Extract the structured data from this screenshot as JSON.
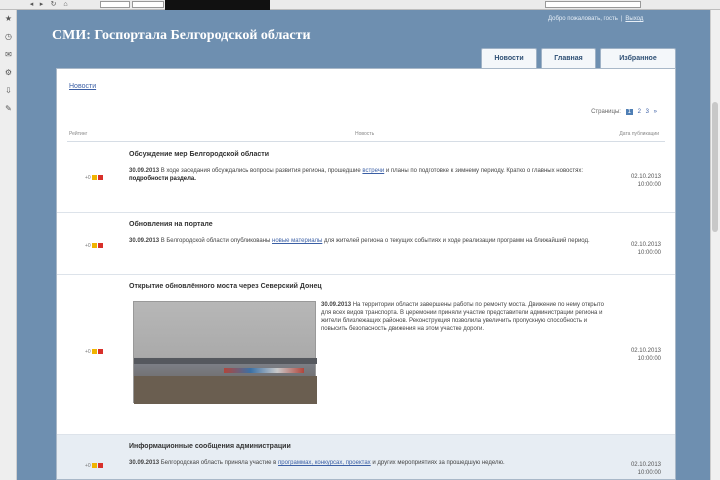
{
  "browser": {
    "nav_icons": [
      "back-icon",
      "forward-icon",
      "reload-icon",
      "home-icon"
    ],
    "url_value": "",
    "search_placeholder": "",
    "right_text": ""
  },
  "header": {
    "top_links": [
      "Добро пожаловать, гость",
      "Выход"
    ],
    "site_title": "СМИ: Госпортала Белгородской области"
  },
  "tabs": [
    {
      "label": "Новости"
    },
    {
      "label": "Главная"
    },
    {
      "label": "Избранное"
    }
  ],
  "main": {
    "breadcrumb": "Новости",
    "pager": {
      "label": "Страницы:",
      "pages": [
        "1",
        "2",
        "3",
        "»"
      ]
    },
    "columns": {
      "rating": "Рейтинг",
      "news": "Новость",
      "date": "Дата публикации"
    },
    "items": [
      {
        "title": "Обсуждение мер Белгородской области",
        "date_text": "30.09.2013",
        "text_a": " В ходе заседания обсуждались вопросы развития региона, прошедшие ",
        "link": "встречи",
        "text_b": " и планы по подготовке к зимнему периоду. Кратко о главных новостях:",
        "bold": " подробности раздела.",
        "rating": "+0",
        "date": "02.10.2013",
        "time": "10:00:00"
      },
      {
        "title": "Обновления на портале",
        "date_text": "30.09.2013",
        "text_a": " В Белгородской области опубликованы ",
        "link": "новые материалы",
        "text_b": " для жителей региона о текущих событиях и ходе реализации программ на ближайший период.",
        "bold": "",
        "rating": "+0",
        "date": "02.10.2013",
        "time": "10:00:00"
      },
      {
        "title": "Открытие обновлённого моста через Северский Донец",
        "date_text": "30.09.2013",
        "text_a": " На территории области завершены работы по ремонту моста. Движение по нему открыто для всех видов транспорта. В церемонии приняли участие представители администрации региона и жители близлежащих районов. Реконструкция позволила увеличить пропускную способность и повысить безопасность движения на этом участке дороги.",
        "link": "",
        "text_b": "",
        "bold": "",
        "rating": "+0",
        "date": "02.10.2013",
        "time": "10:00:00"
      },
      {
        "title": "Информационные сообщения администрации",
        "date_text": "30.09.2013",
        "text_a": " Белгородская область приняла участие в ",
        "link": "программах, конкурсах, проектах",
        "text_b": " и других мероприятиях за прошедшую неделю.",
        "bold": "",
        "rating": "+0",
        "date": "02.10.2013",
        "time": "10:00:00"
      }
    ]
  }
}
